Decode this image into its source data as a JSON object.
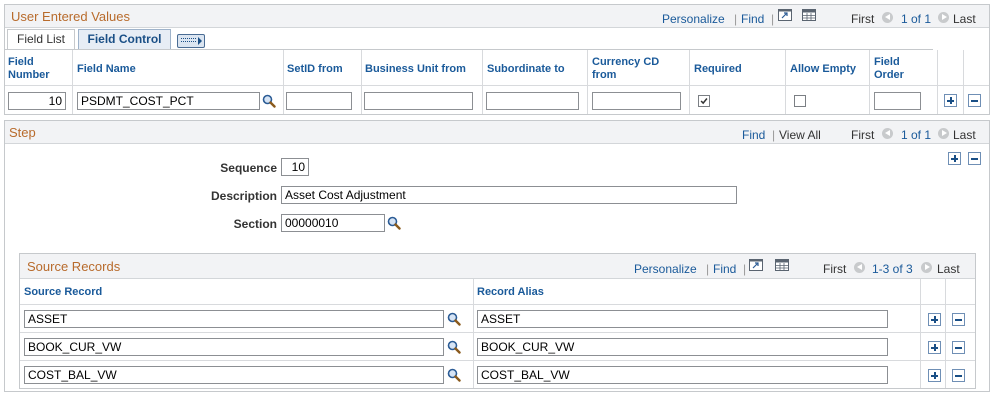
{
  "uev": {
    "title": "User Entered Values",
    "nav": {
      "personalize": "Personalize",
      "sep": "|",
      "find": "Find",
      "first": "First",
      "range": "1 of 1",
      "last": "Last"
    },
    "tabs": [
      {
        "label": "Field List"
      },
      {
        "label": "Field Control"
      }
    ],
    "columns": {
      "field_number": "Field Number",
      "field_name": "Field Name",
      "setid_from": "SetID from",
      "business_unit_from": "Business Unit from",
      "subordinate_to": "Subordinate to",
      "currency_cd_from": "Currency CD from",
      "required": "Required",
      "allow_empty": "Allow Empty",
      "field_order": "Field Order"
    },
    "row": {
      "field_number": "10",
      "field_name": "PSDMT_COST_PCT",
      "required": true,
      "allow_empty": false
    }
  },
  "step": {
    "title": "Step",
    "nav": {
      "find": "Find",
      "sep": "|",
      "view_all": "View All",
      "first": "First",
      "range": "1 of 1",
      "last": "Last"
    },
    "sequence_label": "Sequence",
    "sequence_value": "10",
    "description_label": "Description",
    "description_value": "Asset Cost Adjustment",
    "section_label": "Section",
    "section_value": "00000010"
  },
  "source_records": {
    "title": "Source Records",
    "nav": {
      "personalize": "Personalize",
      "sep": "|",
      "find": "Find",
      "first": "First",
      "range": "1-3 of 3",
      "last": "Last"
    },
    "columns": {
      "source_record": "Source Record",
      "record_alias": "Record Alias"
    },
    "rows": [
      {
        "source_record": "ASSET",
        "record_alias": "ASSET"
      },
      {
        "source_record": "BOOK_CUR_VW",
        "record_alias": "BOOK_CUR_VW"
      },
      {
        "source_record": "COST_BAL_VW",
        "record_alias": "COST_BAL_VW"
      }
    ]
  }
}
